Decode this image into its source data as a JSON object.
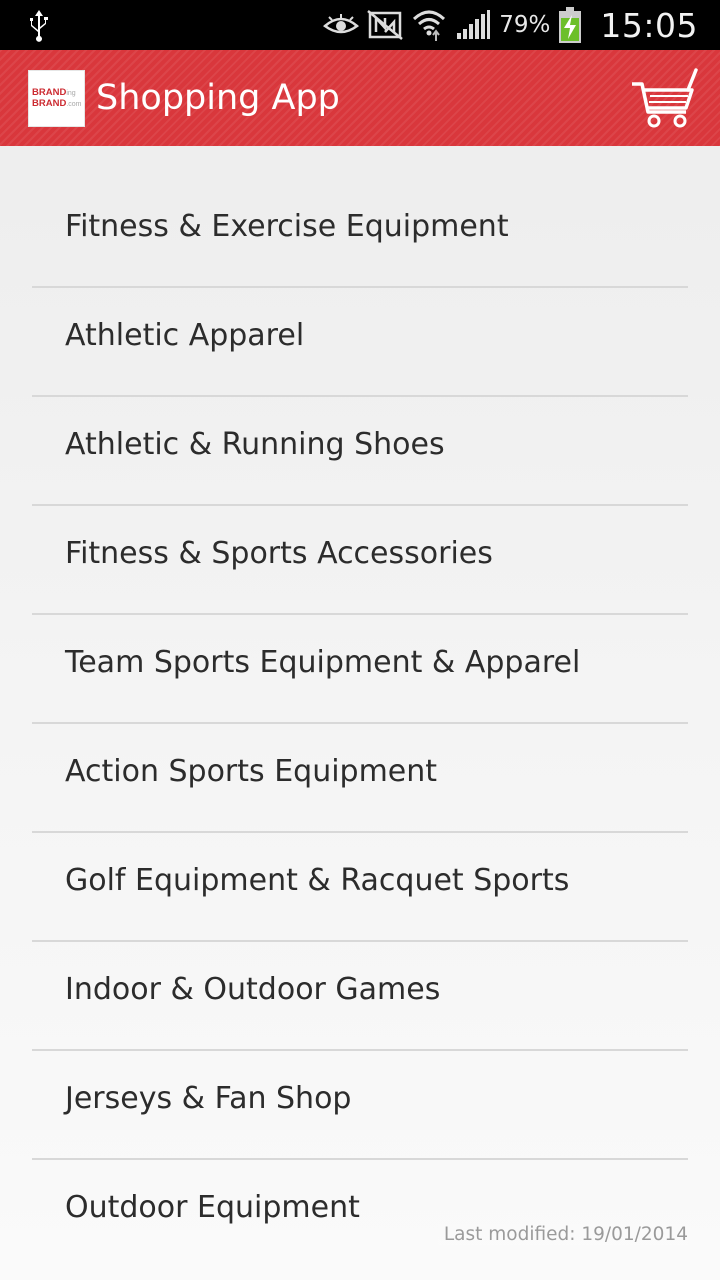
{
  "status_bar": {
    "battery_percent": "79%",
    "time": "15:05",
    "icons": [
      "usb-icon",
      "eye-icon",
      "nfc-icon",
      "wifi-icon",
      "signal-icon",
      "battery-charging-icon"
    ]
  },
  "action_bar": {
    "logo_line1": "BRAND",
    "logo_line1_sub": "ing",
    "logo_line2": "BRAND",
    "logo_line2_sub": ".com",
    "title": "Shopping App",
    "cart_icon": "shopping-cart-icon",
    "color": "#d9373c"
  },
  "categories": [
    {
      "label": "Fitness & Exercise Equipment"
    },
    {
      "label": "Athletic Apparel"
    },
    {
      "label": "Athletic & Running Shoes"
    },
    {
      "label": "Fitness & Sports Accessories"
    },
    {
      "label": "Team Sports Equipment & Apparel"
    },
    {
      "label": "Action Sports Equipment"
    },
    {
      "label": "Golf Equipment & Racquet Sports"
    },
    {
      "label": "Indoor & Outdoor Games"
    },
    {
      "label": "Jerseys & Fan Shop"
    },
    {
      "label": "Outdoor Equipment"
    }
  ],
  "footer": {
    "last_modified": "Last modified: 19/01/2014"
  }
}
